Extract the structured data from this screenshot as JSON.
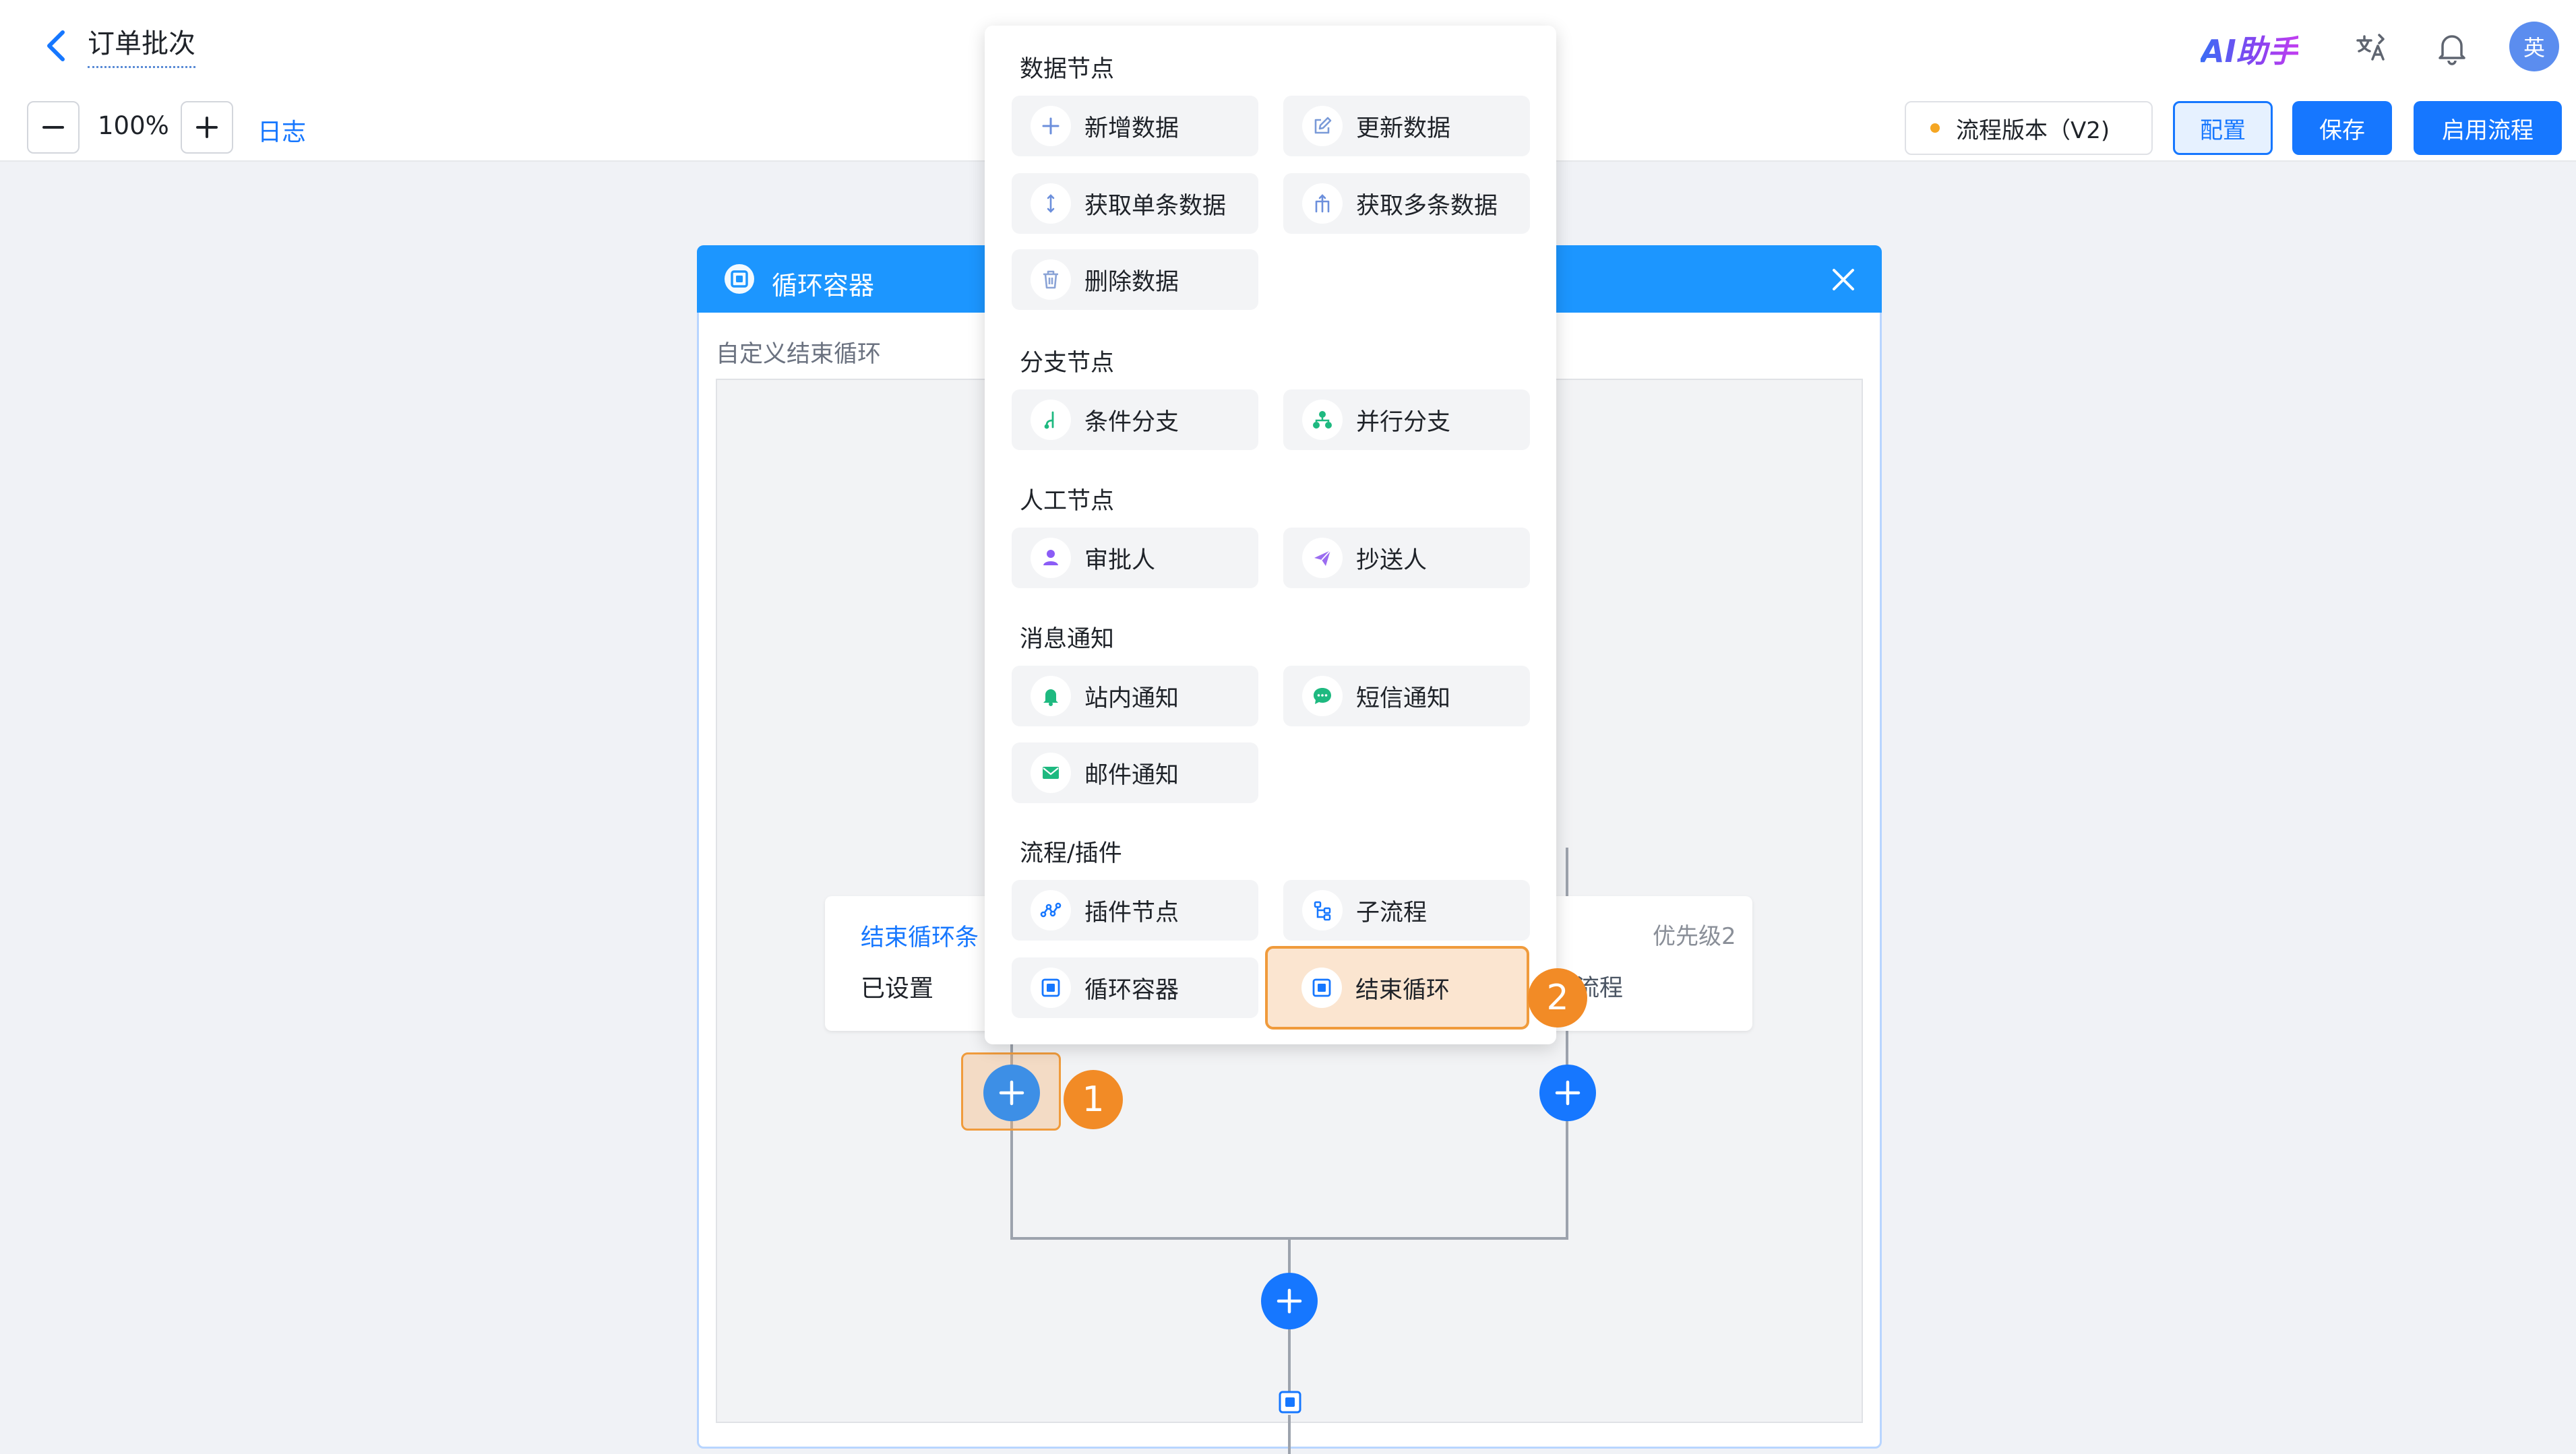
{
  "header": {
    "title": "订单批次",
    "ai_logo": "AI助手",
    "avatar": "英"
  },
  "toolbar": {
    "zoom": "100%",
    "log": "日志",
    "version": "流程版本（V2)",
    "config": "配置",
    "save": "保存",
    "enable": "启用流程"
  },
  "loop_container": {
    "title": "循环容器",
    "subtitle": "自定义结束循环",
    "branch1": {
      "title": "结束循环条",
      "status": "已设置"
    },
    "branch2": {
      "priority": "优先级2",
      "text": "流程"
    }
  },
  "menu": {
    "sections": [
      {
        "title": "数据节点",
        "items": [
          "新增数据",
          "更新数据",
          "获取单条数据",
          "获取多条数据",
          "删除数据"
        ]
      },
      {
        "title": "分支节点",
        "items": [
          "条件分支",
          "并行分支"
        ]
      },
      {
        "title": "人工节点",
        "items": [
          "审批人",
          "抄送人"
        ]
      },
      {
        "title": "消息通知",
        "items": [
          "站内通知",
          "短信通知",
          "邮件通知"
        ]
      },
      {
        "title": "流程/插件",
        "items": [
          "插件节点",
          "子流程",
          "循环容器",
          "结束循环"
        ]
      }
    ]
  },
  "annotations": {
    "step1": "1",
    "step2": "2"
  },
  "colors": {
    "primary": "#1677ff",
    "highlight": "#f28b26",
    "loop_header": "#1c96ff"
  }
}
